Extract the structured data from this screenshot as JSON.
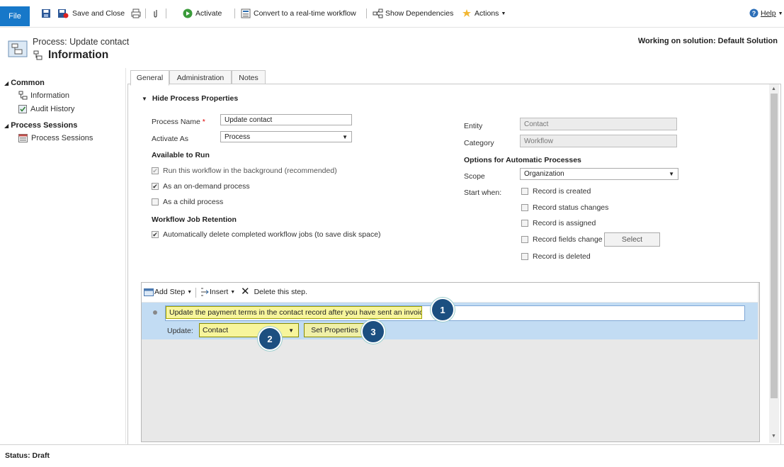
{
  "toolbar": {
    "file": "File",
    "save_and_close": "Save and Close",
    "activate": "Activate",
    "convert": "Convert to a real-time workflow",
    "show_dependencies": "Show Dependencies",
    "actions": "Actions",
    "help": "Help"
  },
  "header": {
    "subtitle": "Process: Update contact",
    "title": "Information",
    "solution": "Working on solution: Default Solution"
  },
  "nav": {
    "common": "Common",
    "information": "Information",
    "audit_history": "Audit History",
    "process_sessions_header": "Process Sessions",
    "process_sessions": "Process Sessions"
  },
  "tabs": [
    "General",
    "Administration",
    "Notes"
  ],
  "section": {
    "toggle": "Hide Process Properties"
  },
  "form": {
    "process_name_label": "Process Name",
    "required_mark": "*",
    "process_name_value": "Update contact",
    "activate_as_label": "Activate As",
    "activate_as_value": "Process",
    "available_to_run": "Available to Run",
    "opt_background": "Run this workflow in the background (recommended)",
    "opt_on_demand": "As an on-demand process",
    "opt_child": "As a child process",
    "retention_header": "Workflow Job Retention",
    "opt_auto_delete": "Automatically delete completed workflow jobs (to save disk space)",
    "entity_label": "Entity",
    "entity_value": "Contact",
    "category_label": "Category",
    "category_value": "Workflow",
    "options_header": "Options for Automatic Processes",
    "scope_label": "Scope",
    "scope_value": "Organization",
    "start_when_label": "Start when:",
    "start_created": "Record is created",
    "start_status": "Record status changes",
    "start_assigned": "Record is assigned",
    "start_fields": "Record fields change",
    "select_button": "Select",
    "start_deleted": "Record is deleted"
  },
  "steps": {
    "add_step": "Add Step",
    "insert": "Insert",
    "delete_step": "Delete this step.",
    "description": "Update the payment terms in the contact record after you have sent an invoice.",
    "update_label": "Update:",
    "update_value": "Contact",
    "set_properties": "Set Properties"
  },
  "callouts": [
    "1",
    "2",
    "3"
  ],
  "status": "Status: Draft",
  "colors": {
    "file_blue": "#1778c9",
    "step_band": "#c2dcf3",
    "highlight": "#f7f59c",
    "callout": "#1c4f80"
  }
}
